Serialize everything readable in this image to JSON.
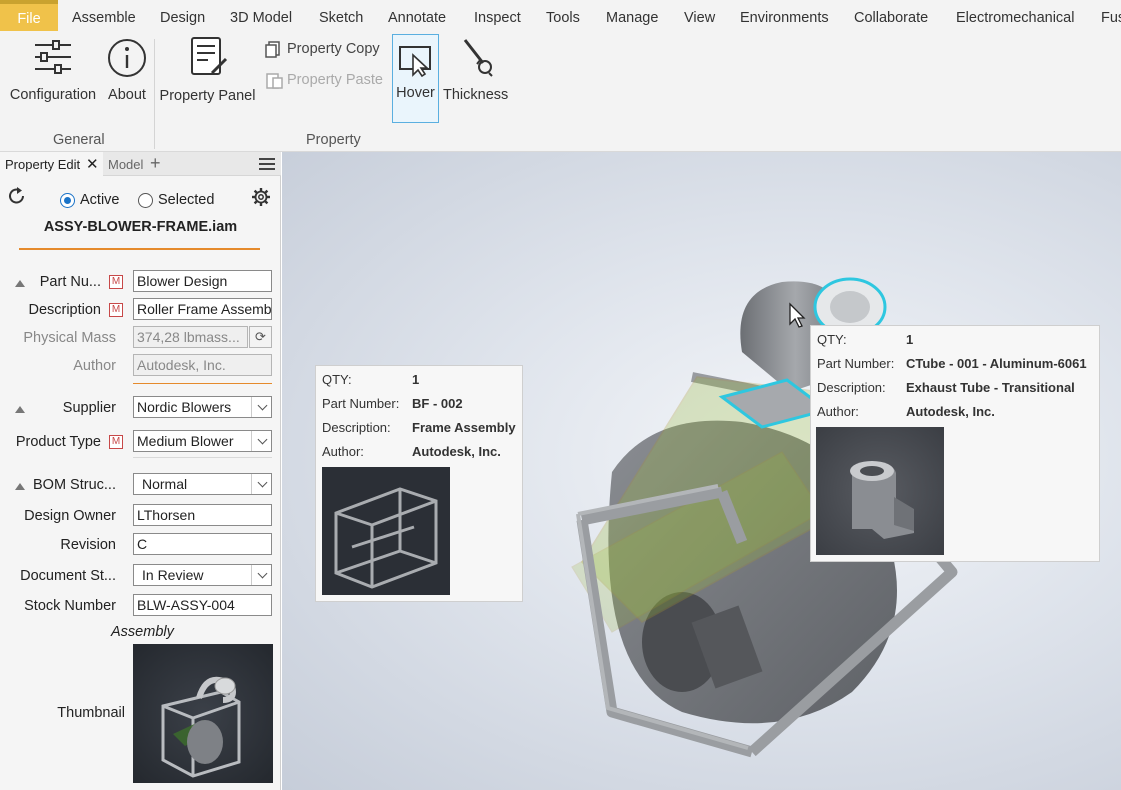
{
  "menu": {
    "items": [
      "File",
      "Assemble",
      "Design",
      "3D Model",
      "Sketch",
      "Annotate",
      "Inspect",
      "Tools",
      "Manage",
      "View",
      "Environments",
      "Collaborate",
      "Electromechanical",
      "Fus"
    ]
  },
  "ribbon": {
    "configuration": "Configuration",
    "about": "About",
    "group_general": "General",
    "property_panel": "Property Panel",
    "property_copy": "Property Copy",
    "property_paste": "Property Paste",
    "hover": "Hover",
    "thickness": "Thickness",
    "group_property": "Property"
  },
  "panel": {
    "tab_property_edit": "Property Edit",
    "tab_model": "Model",
    "radio_active": "Active",
    "radio_selected": "Selected",
    "active_radio_checked": true,
    "filename": "ASSY-BLOWER-FRAME.iam",
    "mandatory_marker": "M",
    "fields": {
      "part_number": {
        "label": "Part Nu...",
        "value": "Blower Design"
      },
      "description": {
        "label": "Description",
        "value": "Roller Frame Assembly"
      },
      "physical_mass": {
        "label": "Physical Mass",
        "value": "374,28 lbmass..."
      },
      "author": {
        "label": "Author",
        "value": "Autodesk, Inc."
      },
      "supplier": {
        "label": "Supplier",
        "value": "Nordic Blowers"
      },
      "product_type": {
        "label": "Product Type",
        "value": "Medium Blower"
      },
      "bom_structure": {
        "label": "BOM Struc...",
        "value": "Normal"
      },
      "design_owner": {
        "label": "Design Owner",
        "value": "LThorsen"
      },
      "revision": {
        "label": "Revision",
        "value": "C"
      },
      "document_status": {
        "label": "Document St...",
        "value": "In Review"
      },
      "stock_number": {
        "label": "Stock Number",
        "value": "BLW-ASSY-004"
      }
    },
    "assembly_caption": "Assembly",
    "thumbnail_label": "Thumbnail"
  },
  "tooltips": {
    "frame": {
      "qty_label": "QTY:",
      "qty": "1",
      "part_number_label": "Part Number:",
      "part_number": "BF - 002",
      "description_label": "Description:",
      "description": "Frame Assembly",
      "author_label": "Author:",
      "author": "Autodesk, Inc."
    },
    "tube": {
      "qty_label": "QTY:",
      "qty": "1",
      "part_number_label": "Part Number:",
      "part_number": "CTube - 001 - Aluminum-6061",
      "description_label": "Description:",
      "description": "Exhaust Tube - Transitional",
      "author_label": "Author:",
      "author": "Autodesk, Inc."
    }
  },
  "colors": {
    "file_tab": "#f0c24a",
    "accent_orange": "#e58a2c",
    "selection_cyan": "#2ec7e0",
    "radio_blue": "#1a73c8",
    "mandatory_red": "#c74848"
  }
}
